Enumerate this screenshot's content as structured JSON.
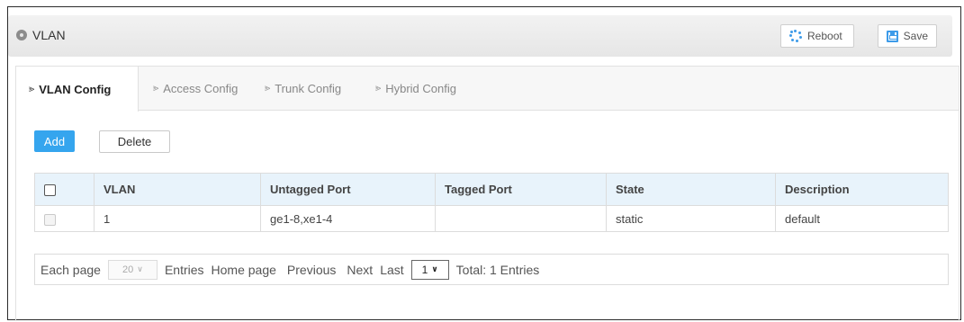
{
  "header": {
    "title": "VLAN",
    "reboot_label": "Reboot",
    "save_label": "Save"
  },
  "tabs": [
    {
      "label": "VLAN Config",
      "active": true
    },
    {
      "label": "Access Config",
      "active": false
    },
    {
      "label": "Trunk Config",
      "active": false
    },
    {
      "label": "Hybrid Config",
      "active": false
    }
  ],
  "toolbar": {
    "add_label": "Add",
    "delete_label": "Delete"
  },
  "table": {
    "columns": [
      "VLAN",
      "Untagged Port",
      "Tagged Port",
      "State",
      "Description"
    ],
    "rows": [
      {
        "vlan": "1",
        "untagged": "ge1-8,xe1-4",
        "tagged": "",
        "state": "static",
        "description": "default"
      }
    ]
  },
  "pager": {
    "each_page": "Each page",
    "page_size": "20",
    "entries": "Entries",
    "home": "Home page",
    "previous": "Previous",
    "next": "Next",
    "last": "Last",
    "current_page": "1",
    "total": "Total: 1 Entries"
  },
  "colors": {
    "accent": "#35a5ee",
    "header_bg": "#e6e6e6",
    "table_header_bg": "#e8f3fb"
  }
}
